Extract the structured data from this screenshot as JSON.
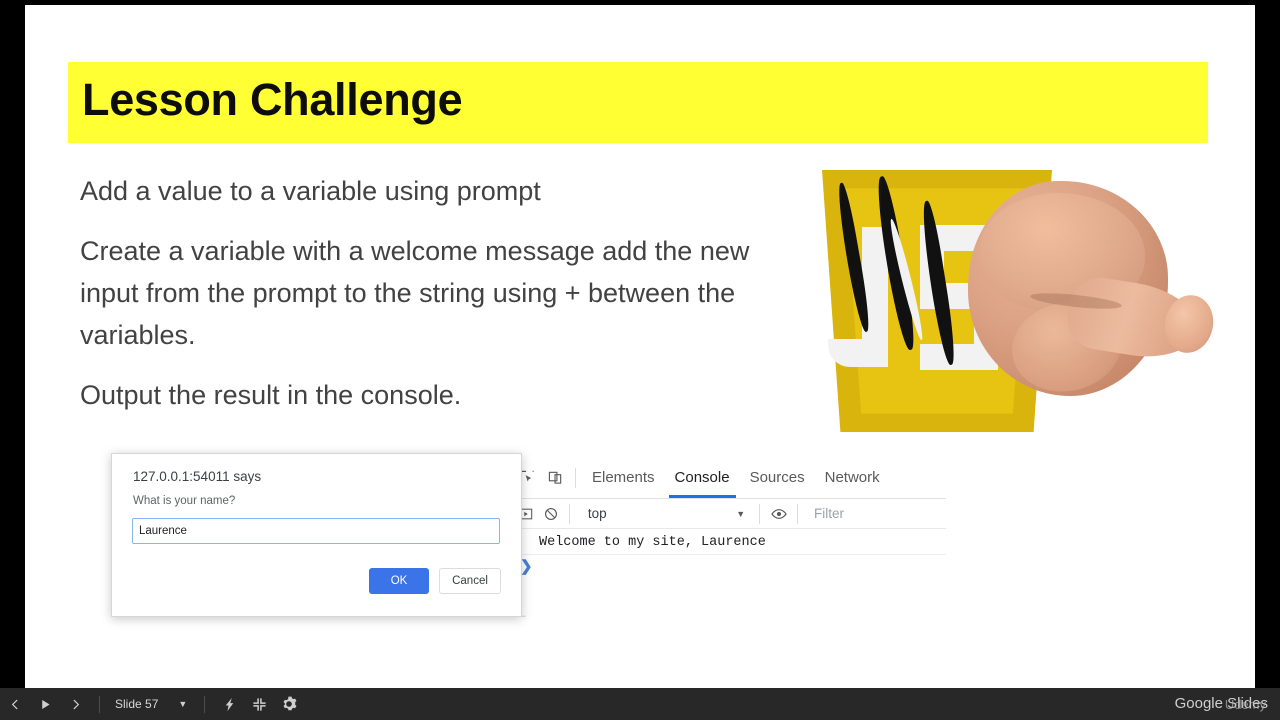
{
  "slide": {
    "title": "Lesson Challenge",
    "paragraphs": [
      "Add a value to a variable using prompt",
      "Create a variable with a welcome message add the new input from the prompt to the string using + between the variables.",
      "Output the result in the console."
    ],
    "banner_color": "#ffff33",
    "logo_alt": "javascript-logo-with-claw-and-pointing-hand",
    "logo_color": "#d9b40d"
  },
  "prompt_dialog": {
    "origin": "127.0.0.1:54011 says",
    "question": "What is your name?",
    "input_value": "Laurence",
    "input_placeholder": "",
    "ok_label": "OK",
    "cancel_label": "Cancel",
    "ok_color": "#3b73e8"
  },
  "devtools": {
    "tabs": [
      {
        "label": "Elements",
        "active": false
      },
      {
        "label": "Console",
        "active": true
      },
      {
        "label": "Sources",
        "active": false
      },
      {
        "label": "Network",
        "active": false
      }
    ],
    "context_selector": "top",
    "filter_placeholder": "Filter",
    "console_output": "Welcome to my site, Laurence",
    "prompt_chevron": "❯",
    "active_tab_color": "#1a73e8"
  },
  "bottom_bar": {
    "slide_label": "Slide 57",
    "caret": "▼",
    "brand": "Google Slides",
    "watermark": "Udemy"
  }
}
